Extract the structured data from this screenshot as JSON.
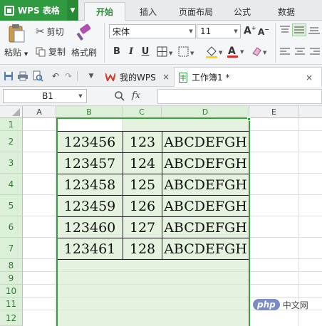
{
  "app": {
    "title": "WPS 表格"
  },
  "menu_tabs": [
    {
      "label": "开始",
      "active": true
    },
    {
      "label": "插入"
    },
    {
      "label": "页面布局"
    },
    {
      "label": "公式"
    },
    {
      "label": "数据"
    }
  ],
  "ribbon": {
    "paste_label": "粘贴",
    "cut_label": "剪切",
    "copy_label": "复制",
    "format_painter_label": "格式刷",
    "font_name": "宋体",
    "font_size": "11",
    "bold": "B",
    "italic": "I",
    "underline": "U",
    "grow_font": "A",
    "shrink_font": "A",
    "font_color_letter": "A"
  },
  "doc_tabs": [
    {
      "label": "我的WPS",
      "close": "×"
    },
    {
      "label": "工作簿1 *",
      "close": "×",
      "active": true
    }
  ],
  "formula_bar": {
    "name_box": "B1",
    "fx": "fx",
    "formula": ""
  },
  "sheet": {
    "columns": [
      "A",
      "B",
      "C",
      "D",
      "E"
    ],
    "rows": [
      "1",
      "2",
      "3",
      "4",
      "5",
      "6",
      "7",
      "8",
      "9",
      "10",
      "11",
      "12"
    ],
    "data": [
      [
        "123456",
        "123",
        "ABCDEFGH"
      ],
      [
        "123457",
        "124",
        "ABCDEFGH"
      ],
      [
        "123458",
        "125",
        "ABCDEFGH"
      ],
      [
        "123459",
        "126",
        "ABCDEFGH"
      ],
      [
        "123460",
        "127",
        "ABCDEFGH"
      ],
      [
        "123461",
        "128",
        "ABCDEFGH"
      ]
    ],
    "selected_columns": [
      "B",
      "C",
      "D"
    ],
    "selection_fill": "#e4f2df",
    "selection_border": "#3a9d3f"
  },
  "watermark": {
    "logo": "php",
    "text": "中文网"
  },
  "colors": {
    "brand": "#2f9a3f",
    "accent": "#2f8f3a"
  }
}
